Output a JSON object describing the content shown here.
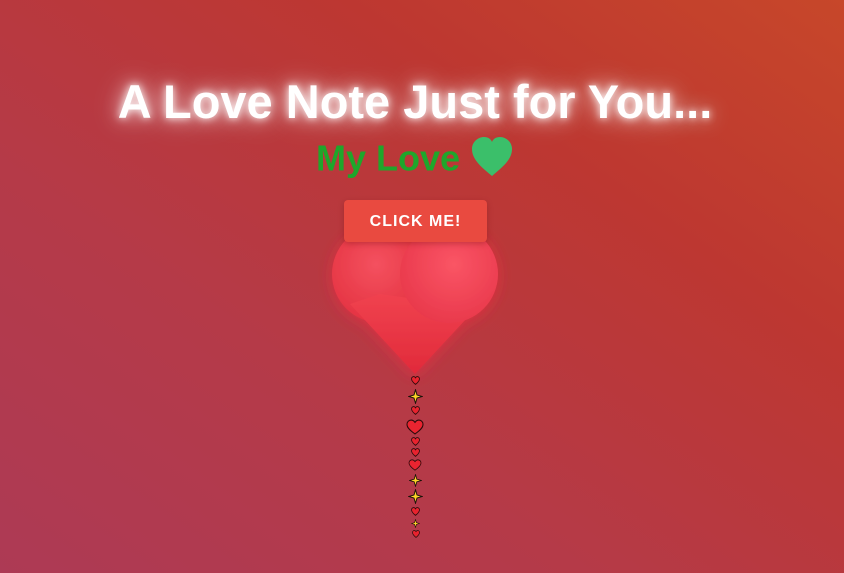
{
  "header": {
    "title": "A Love Note Just for You...",
    "subtitle": "My Love"
  },
  "icons": {
    "subtitle_icon": "green-heart-icon",
    "main_icon": "big-heart-icon",
    "trail_icons": [
      "small-heart-icon",
      "sparkle-icon",
      "heart-icon",
      "sparkle-icon"
    ]
  },
  "button": {
    "label": "CLICK ME!"
  },
  "colors": {
    "background_start": "#ad3a55",
    "background_end": "#c7472a",
    "subtitle_text": "#1fa62b",
    "subtitle_heart": "#3bbf6a",
    "big_heart": "#ef3f50",
    "button_bg": "#e94a40",
    "sparkle": "#ffd42a"
  }
}
